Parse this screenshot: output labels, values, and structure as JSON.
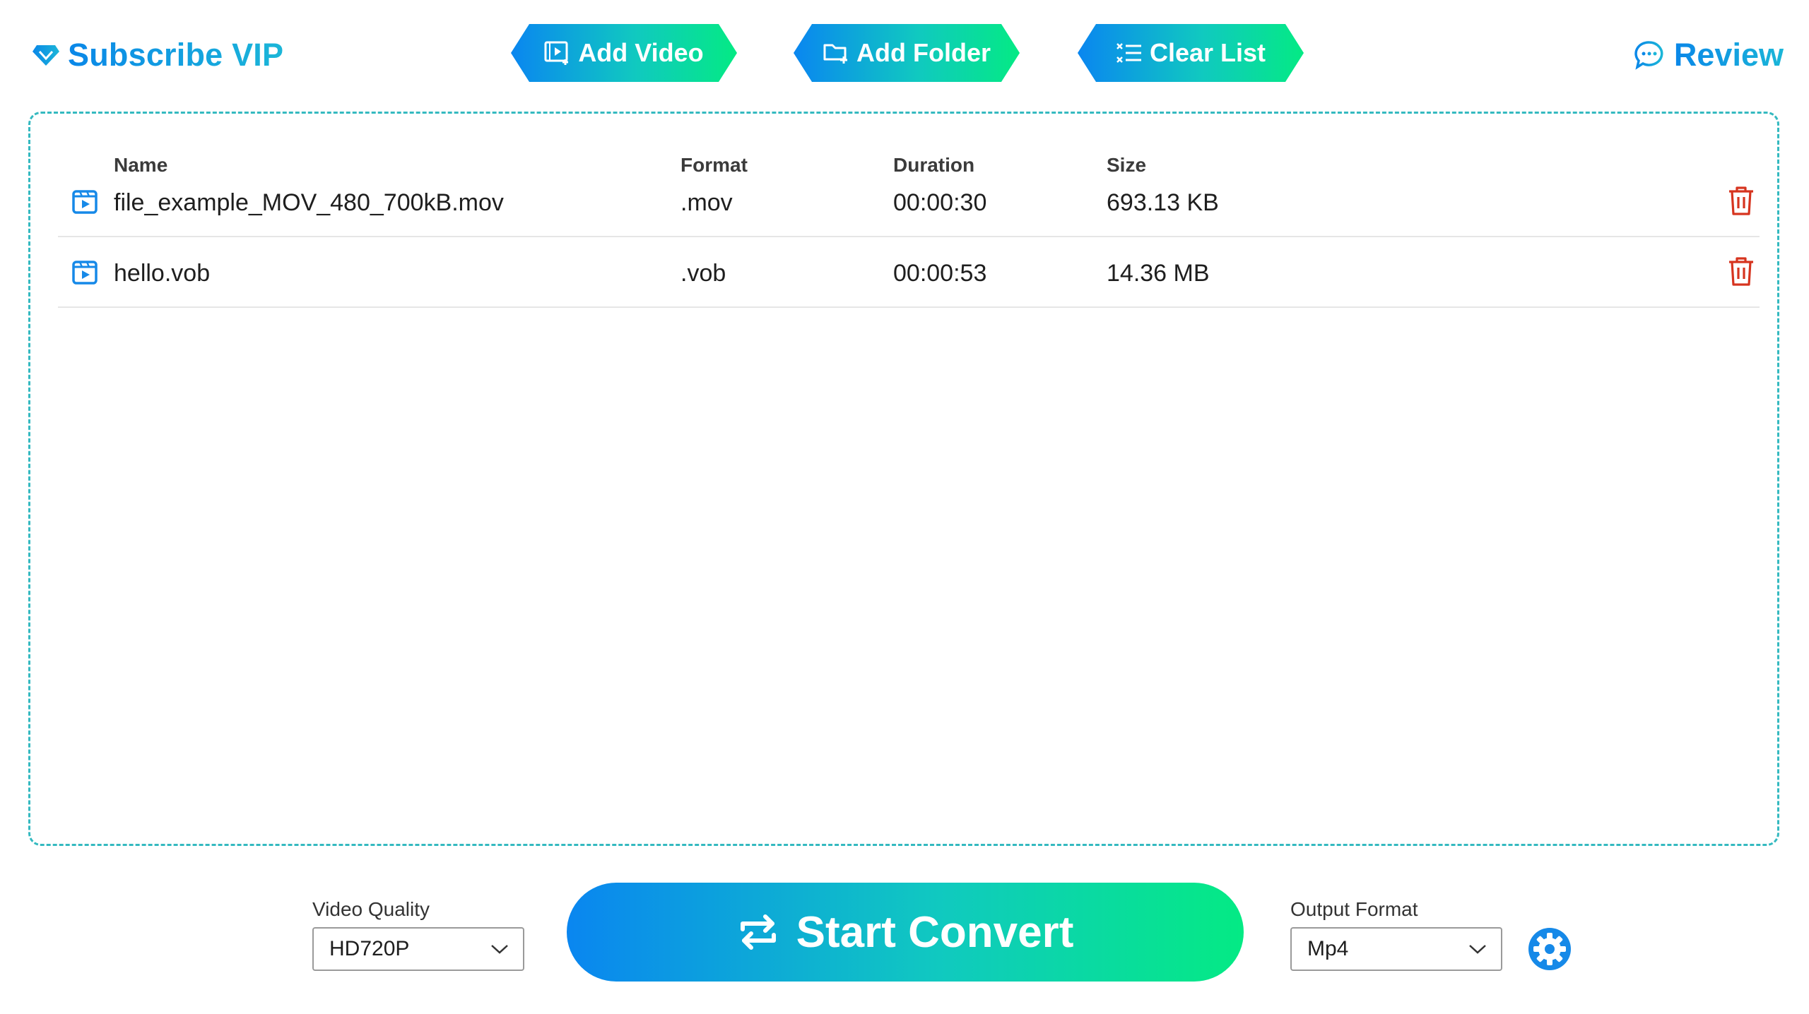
{
  "header": {
    "subscribe_label": "Subscribe VIP",
    "review_label": "Review",
    "toolbar": {
      "add_video": "Add Video",
      "add_folder": "Add Folder",
      "clear_list": "Clear List"
    }
  },
  "file_list": {
    "columns": {
      "name": "Name",
      "format": "Format",
      "duration": "Duration",
      "size": "Size"
    },
    "rows": [
      {
        "name": "file_example_MOV_480_700kB.mov",
        "format": ".mov",
        "duration": "00:00:30",
        "size": "693.13 KB"
      },
      {
        "name": "hello.vob",
        "format": ".vob",
        "duration": "00:00:53",
        "size": "14.36 MB"
      }
    ]
  },
  "controls": {
    "video_quality": {
      "label": "Video Quality",
      "value": "HD720P"
    },
    "start_convert": "Start Convert",
    "output_format": {
      "label": "Output Format",
      "value": "Mp4"
    }
  },
  "colors": {
    "accent_blue": "#0a86f0",
    "accent_green": "#04ea84",
    "delete_red": "#d6341f",
    "panel_border": "#34b9c0"
  },
  "icons": {
    "subscribe": "diamond-icon",
    "review": "chat-bubble-icon",
    "add_video": "video-add-icon",
    "add_folder": "folder-add-icon",
    "clear_list": "clear-list-icon",
    "row_file": "video-file-icon",
    "delete": "trash-icon",
    "convert": "convert-arrows-icon",
    "dropdown": "chevron-down-icon",
    "settings": "gear-icon"
  }
}
